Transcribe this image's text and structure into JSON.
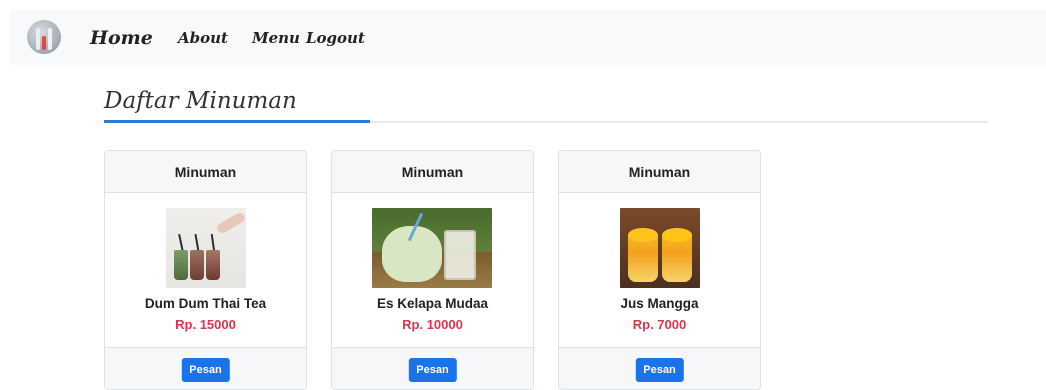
{
  "nav": {
    "home": "Home",
    "about": "About",
    "menu": "Menu",
    "logout": "Logout",
    "logo_icon": "utensils-logo-icon"
  },
  "page": {
    "heading": "Daftar Minuman",
    "accent_color": "#2a7bd6"
  },
  "cards": [
    {
      "category": "Minuman",
      "name": "Dum Dum Thai Tea",
      "price": "Rp. 15000",
      "button": "Pesan"
    },
    {
      "category": "Minuman",
      "name": "Es Kelapa Mudaa",
      "price": "Rp. 10000",
      "button": "Pesan"
    },
    {
      "category": "Minuman",
      "name": "Jus Mangga",
      "price": "Rp. 7000",
      "button": "Pesan"
    }
  ],
  "colors": {
    "price": "#d9364b",
    "button": "#1a73e8"
  }
}
